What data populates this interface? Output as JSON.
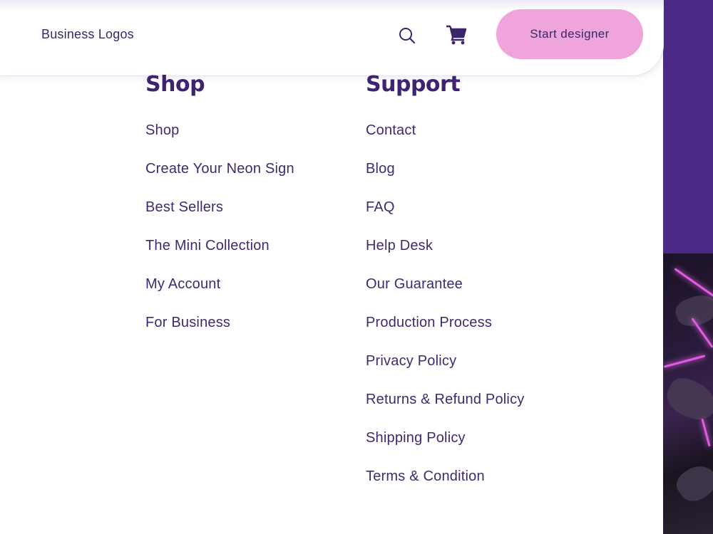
{
  "header": {
    "nav_link": "Business Logos",
    "cta_label": "Start designer",
    "icons": [
      "search-icon",
      "cart-icon"
    ]
  },
  "shop": {
    "title": "Shop",
    "items": [
      "Shop",
      "Create Your Neon Sign",
      "Best Sellers",
      "The Mini Collection",
      "My Account",
      "For Business"
    ]
  },
  "support": {
    "title": "Support",
    "items": [
      "Contact",
      "Blog",
      "FAQ",
      "Help Desk",
      "Our Guarantee",
      "Production Process",
      "Privacy Policy",
      "Returns & Refund Policy",
      "Shipping Policy",
      "Terms & Condition"
    ]
  },
  "colors": {
    "brand_purple": "#4a2a86",
    "text_purple": "#3f2a6e",
    "cta_pink": "#efa5dc"
  }
}
